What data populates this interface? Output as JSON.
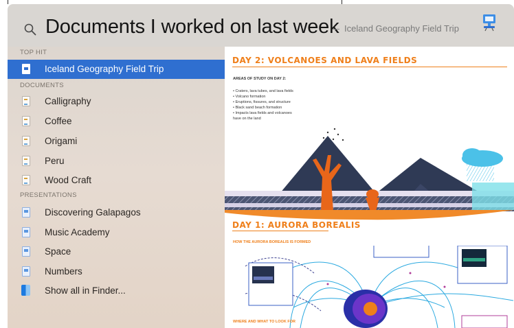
{
  "search": {
    "query": "Documents I worked on last week",
    "suggestion": "Iceland Geography Field Trip"
  },
  "sidebar": {
    "top_hit_header": "TOP HIT",
    "top_hit": "Iceland Geography Field Trip",
    "documents_header": "DOCUMENTS",
    "documents": [
      "Calligraphy",
      "Coffee",
      "Origami",
      "Peru",
      "Wood Craft"
    ],
    "presentations_header": "PRESENTATIONS",
    "presentations": [
      "Discovering Galapagos",
      "Music Academy",
      "Space",
      "Numbers"
    ],
    "show_all": "Show all in Finder..."
  },
  "preview": {
    "section1_title": "DAY 2: VOLCANOES AND LAVA FIELDS",
    "study_heading": "AREAS OF STUDY ON DAY 2:",
    "study_items": [
      "• Craters, lava tubes, and lava fields",
      "• Volcano formation",
      "• Eruptions, fissures, and structure",
      "• Black sand beach formation",
      "• Impacts lava fields and volcanoes",
      "  have on the land"
    ],
    "section2_title": "DAY 1: AURORA BOREALIS",
    "aurora_sub": "HOW THE AURORA BOREALIS IS FORMED",
    "bottom_sub": "WHERE AND WHAT TO LOOK FOR",
    "colors": {
      "accent": "#ef7f1a",
      "aurora_lines": "#2aa9e0",
      "mountain": "#2f3a55",
      "lava": "#e8661a"
    }
  },
  "colors": {
    "selection": "#2f6fd0",
    "sidebar_bg": "#e3d8cf",
    "search_bg": "#d9d6d2"
  }
}
